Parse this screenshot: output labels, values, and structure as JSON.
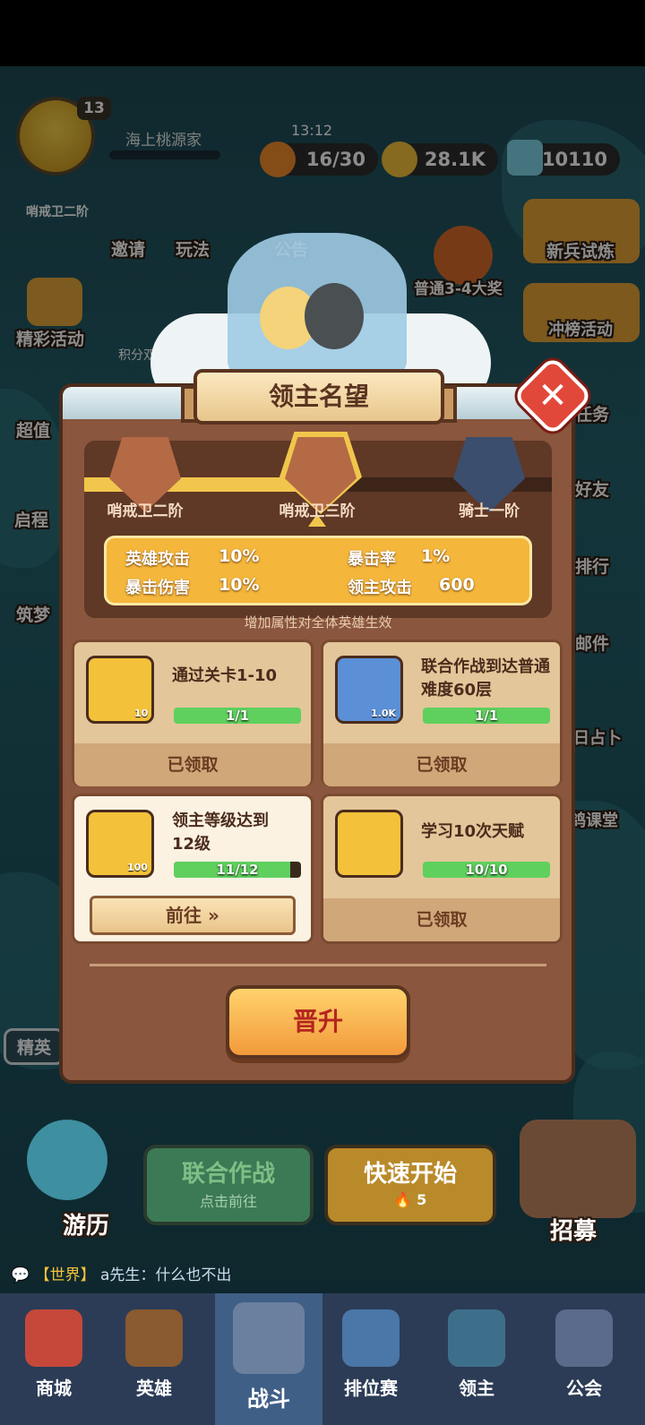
{
  "hud": {
    "level": "13",
    "rank_badge": "哨戒卫二阶",
    "player_name": "海上桃源家",
    "timer": "13:12",
    "stamina": "16/30",
    "gold": "28.1K",
    "gems": "10110"
  },
  "left_menu": [
    {
      "label": "邀请"
    },
    {
      "label": "玩法"
    },
    {
      "label": "公告"
    },
    {
      "label": "精彩活动"
    },
    {
      "label": "积分双倍"
    },
    {
      "label": "超值"
    },
    {
      "label": "启程"
    },
    {
      "label": "筑梦"
    },
    {
      "label": "精英"
    }
  ],
  "right_menu": [
    {
      "label": "新兵试炼"
    },
    {
      "label": "普通3-4大奖"
    },
    {
      "label": "冲榜活动"
    },
    {
      "label": "任务"
    },
    {
      "label": "好友"
    },
    {
      "label": "排行"
    },
    {
      "label": "邮件"
    },
    {
      "label": "日占卜"
    },
    {
      "label": "鸽课堂"
    }
  ],
  "dialog": {
    "title": "领主名望",
    "ranks": [
      {
        "label": "哨戒卫二阶",
        "color": "#b46a45"
      },
      {
        "label": "哨戒卫三阶",
        "color": "#b46a45"
      },
      {
        "label": "骑士一阶",
        "color": "#3b4e6e"
      }
    ],
    "progress": 0.5,
    "stats": [
      {
        "key": "英雄攻击",
        "value": "10%"
      },
      {
        "key": "暴击率",
        "value": "1%"
      },
      {
        "key": "暴击伤害",
        "value": "10%"
      },
      {
        "key": "领主攻击",
        "value": "600"
      }
    ],
    "note": "增加属性对全体英雄生效",
    "tasks": [
      {
        "name": "通过关卡1-10",
        "qty": "10",
        "progress": "1/1",
        "ratio": 1.0,
        "status": "已领取",
        "icon": "key-icon",
        "icon_color": "#f3c23a"
      },
      {
        "name": "联合作战到达普通难度60层",
        "qty": "1.0K",
        "progress": "1/1",
        "ratio": 1.0,
        "status": "已领取",
        "icon": "gold-coin-icon",
        "icon_color": "#5b8fd6"
      },
      {
        "name": "领主等级达到12级",
        "qty": "100",
        "progress": "11/12",
        "ratio": 0.917,
        "status": "前往",
        "icon": "crystal-icon",
        "icon_color": "#f3c23a"
      },
      {
        "name": "学习10次天赋",
        "qty": "",
        "progress": "10/10",
        "ratio": 1.0,
        "status": "已领取",
        "icon": "pickaxe-icon",
        "icon_color": "#f3c23a"
      }
    ],
    "promote_label": "晋升"
  },
  "bottom": {
    "travel": "游历",
    "coop_title": "联合作战",
    "coop_sub": "点击前往",
    "quick_title": "快速开始",
    "quick_cost": "5",
    "recruit": "招募",
    "chat_channel": "【世界】",
    "chat_text": "a先生：什么也不出"
  },
  "nav": [
    {
      "label": "商城",
      "icon": "shop-icon"
    },
    {
      "label": "英雄",
      "icon": "hero-card-icon"
    },
    {
      "label": "战斗",
      "icon": "battle-icon"
    },
    {
      "label": "排位赛",
      "icon": "ranked-icon"
    },
    {
      "label": "领主",
      "icon": "lord-icon"
    },
    {
      "label": "公会",
      "icon": "guild-icon"
    }
  ]
}
